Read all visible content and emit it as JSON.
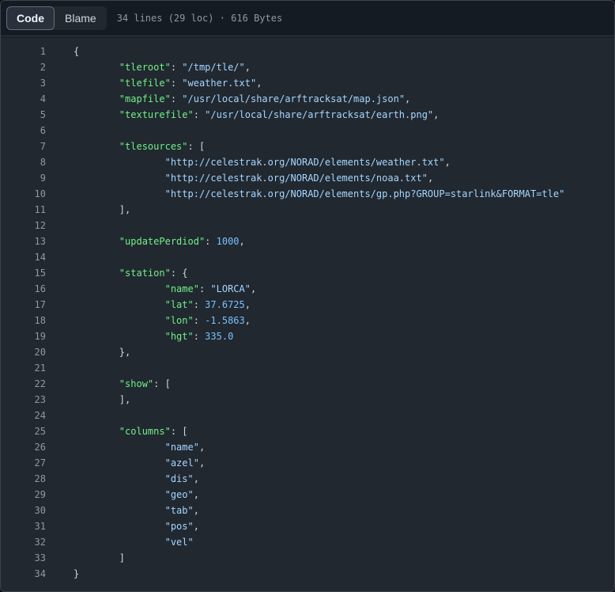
{
  "toolbar": {
    "tabs": [
      {
        "label": "Code",
        "active": true
      },
      {
        "label": "Blame",
        "active": false
      }
    ],
    "file_meta": "34 lines (29 loc) · 616 Bytes"
  },
  "colors": {
    "background": "#212830",
    "key": "#72f088",
    "string": "#a5d6ff",
    "number": "#79c0ff",
    "line_number": "#9198a1"
  },
  "code": {
    "lines": [
      [
        {
          "t": "p",
          "v": "{"
        }
      ],
      [
        {
          "t": "p",
          "v": "\t"
        },
        {
          "t": "k",
          "v": "\"tleroot\""
        },
        {
          "t": "p",
          "v": ": "
        },
        {
          "t": "s",
          "v": "\"/tmp/tle/\""
        },
        {
          "t": "p",
          "v": ","
        }
      ],
      [
        {
          "t": "p",
          "v": "\t"
        },
        {
          "t": "k",
          "v": "\"tlefile\""
        },
        {
          "t": "p",
          "v": ": "
        },
        {
          "t": "s",
          "v": "\"weather.txt\""
        },
        {
          "t": "p",
          "v": ","
        }
      ],
      [
        {
          "t": "p",
          "v": "\t"
        },
        {
          "t": "k",
          "v": "\"mapfile\""
        },
        {
          "t": "p",
          "v": ": "
        },
        {
          "t": "s",
          "v": "\"/usr/local/share/arftracksat/map.json\""
        },
        {
          "t": "p",
          "v": ","
        }
      ],
      [
        {
          "t": "p",
          "v": "\t"
        },
        {
          "t": "k",
          "v": "\"texturefile\""
        },
        {
          "t": "p",
          "v": ": "
        },
        {
          "t": "s",
          "v": "\"/usr/local/share/arftracksat/earth.png\""
        },
        {
          "t": "p",
          "v": ","
        }
      ],
      [],
      [
        {
          "t": "p",
          "v": "\t"
        },
        {
          "t": "k",
          "v": "\"tlesources\""
        },
        {
          "t": "p",
          "v": ": ["
        }
      ],
      [
        {
          "t": "p",
          "v": "\t\t"
        },
        {
          "t": "s",
          "v": "\"http://celestrak.org/NORAD/elements/weather.txt\""
        },
        {
          "t": "p",
          "v": ","
        }
      ],
      [
        {
          "t": "p",
          "v": "\t\t"
        },
        {
          "t": "s",
          "v": "\"http://celestrak.org/NORAD/elements/noaa.txt\""
        },
        {
          "t": "p",
          "v": ","
        }
      ],
      [
        {
          "t": "p",
          "v": "\t\t"
        },
        {
          "t": "s",
          "v": "\"http://celestrak.org/NORAD/elements/gp.php?GROUP=starlink&FORMAT=tle\""
        }
      ],
      [
        {
          "t": "p",
          "v": "\t],"
        }
      ],
      [],
      [
        {
          "t": "p",
          "v": "\t"
        },
        {
          "t": "k",
          "v": "\"updatePerdiod\""
        },
        {
          "t": "p",
          "v": ": "
        },
        {
          "t": "n",
          "v": "1000"
        },
        {
          "t": "p",
          "v": ","
        }
      ],
      [],
      [
        {
          "t": "p",
          "v": "\t"
        },
        {
          "t": "k",
          "v": "\"station\""
        },
        {
          "t": "p",
          "v": ": {"
        }
      ],
      [
        {
          "t": "p",
          "v": "\t\t"
        },
        {
          "t": "k",
          "v": "\"name\""
        },
        {
          "t": "p",
          "v": ": "
        },
        {
          "t": "s",
          "v": "\"LORCA\""
        },
        {
          "t": "p",
          "v": ","
        }
      ],
      [
        {
          "t": "p",
          "v": "\t\t"
        },
        {
          "t": "k",
          "v": "\"lat\""
        },
        {
          "t": "p",
          "v": ": "
        },
        {
          "t": "n",
          "v": "37.6725"
        },
        {
          "t": "p",
          "v": ","
        }
      ],
      [
        {
          "t": "p",
          "v": "\t\t"
        },
        {
          "t": "k",
          "v": "\"lon\""
        },
        {
          "t": "p",
          "v": ": "
        },
        {
          "t": "n",
          "v": "-1.5863"
        },
        {
          "t": "p",
          "v": ","
        }
      ],
      [
        {
          "t": "p",
          "v": "\t\t"
        },
        {
          "t": "k",
          "v": "\"hgt\""
        },
        {
          "t": "p",
          "v": ": "
        },
        {
          "t": "n",
          "v": "335.0"
        }
      ],
      [
        {
          "t": "p",
          "v": "\t},"
        }
      ],
      [],
      [
        {
          "t": "p",
          "v": "\t"
        },
        {
          "t": "k",
          "v": "\"show\""
        },
        {
          "t": "p",
          "v": ": ["
        }
      ],
      [
        {
          "t": "p",
          "v": "\t],"
        }
      ],
      [],
      [
        {
          "t": "p",
          "v": "\t"
        },
        {
          "t": "k",
          "v": "\"columns\""
        },
        {
          "t": "p",
          "v": ": ["
        }
      ],
      [
        {
          "t": "p",
          "v": "\t\t"
        },
        {
          "t": "s",
          "v": "\"name\""
        },
        {
          "t": "p",
          "v": ","
        }
      ],
      [
        {
          "t": "p",
          "v": "\t\t"
        },
        {
          "t": "s",
          "v": "\"azel\""
        },
        {
          "t": "p",
          "v": ","
        }
      ],
      [
        {
          "t": "p",
          "v": "\t\t"
        },
        {
          "t": "s",
          "v": "\"dis\""
        },
        {
          "t": "p",
          "v": ","
        }
      ],
      [
        {
          "t": "p",
          "v": "\t\t"
        },
        {
          "t": "s",
          "v": "\"geo\""
        },
        {
          "t": "p",
          "v": ","
        }
      ],
      [
        {
          "t": "p",
          "v": "\t\t"
        },
        {
          "t": "s",
          "v": "\"tab\""
        },
        {
          "t": "p",
          "v": ","
        }
      ],
      [
        {
          "t": "p",
          "v": "\t\t"
        },
        {
          "t": "s",
          "v": "\"pos\""
        },
        {
          "t": "p",
          "v": ","
        }
      ],
      [
        {
          "t": "p",
          "v": "\t\t"
        },
        {
          "t": "s",
          "v": "\"vel\""
        }
      ],
      [
        {
          "t": "p",
          "v": "\t]"
        }
      ],
      [
        {
          "t": "p",
          "v": "}"
        }
      ]
    ]
  }
}
